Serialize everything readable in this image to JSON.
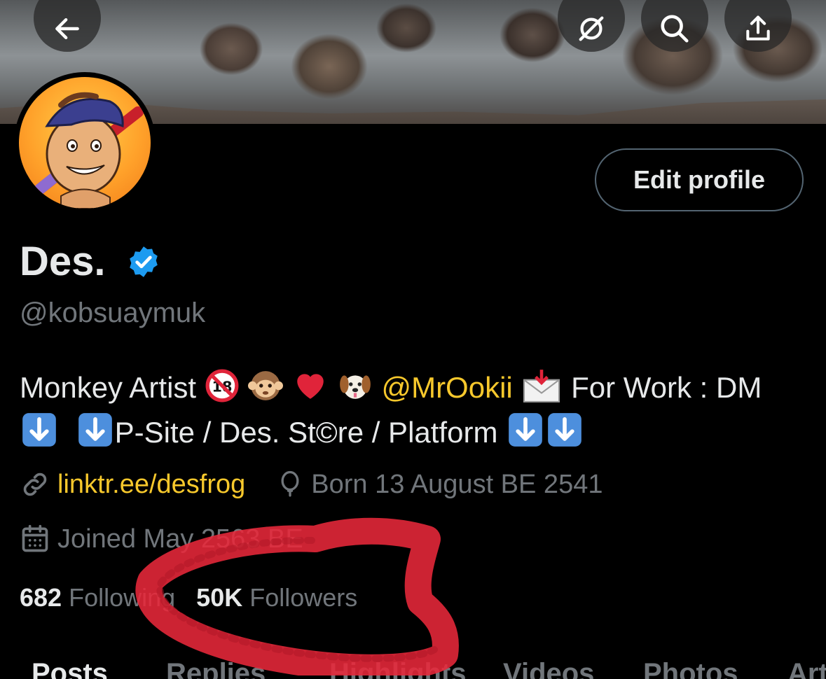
{
  "header": {
    "back_icon": "arrow-left-icon",
    "grok_icon": "slash-circle-icon",
    "search_icon": "search-icon",
    "share_icon": "share-upload-icon"
  },
  "profile": {
    "edit_button": "Edit profile",
    "name": "Des.",
    "handle": "@kobsuaymuk",
    "bio_line1_a": "Monkey Artist",
    "bio_mention": "@MrOokii",
    "bio_line1_b": "For Work : DM",
    "bio_line2": "P-Site / Des. St©re / Platform",
    "link": "linktr.ee/desfrog",
    "birthday": "Born 13 August BE 2541",
    "joined": "Joined May 2563 BE",
    "following_count": "682",
    "following_label": "Following",
    "followers_count": "50K",
    "followers_label": "Followers"
  },
  "tabs": [
    "Posts",
    "Replies",
    "Highlights",
    "Videos",
    "Photos",
    "Articles"
  ],
  "colors": {
    "background": "#000000",
    "text": "#e7e9ea",
    "muted": "#71767b",
    "accent": "#f7c82c",
    "verified": "#1d9bf0",
    "annotation": "#e8283a"
  }
}
